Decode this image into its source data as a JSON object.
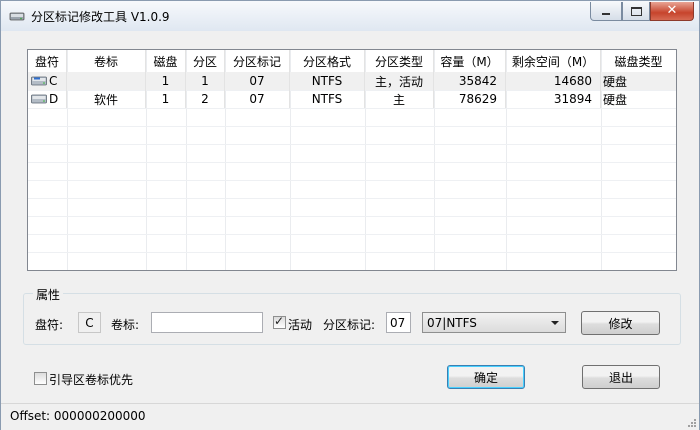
{
  "window": {
    "title": "分区标记修改工具 V1.0.9"
  },
  "titlebar": {
    "minimize": "minimize",
    "maximize": "maximize",
    "close": "✕"
  },
  "table": {
    "columns": [
      "盘符",
      "卷标",
      "磁盘",
      "分区",
      "分区标记",
      "分区格式",
      "分区类型",
      "容量（M）",
      "剩余空间（M）",
      "磁盘类型"
    ],
    "rows": [
      {
        "drive": "C",
        "label": "",
        "disk": "1",
        "partition": "1",
        "mark": "07",
        "format": "NTFS",
        "type": "主，活动",
        "capacity": "35842",
        "free": "14680",
        "disk_type": "硬盘",
        "icon": "drive-c-icon"
      },
      {
        "drive": "D",
        "label": "软件",
        "disk": "1",
        "partition": "2",
        "mark": "07",
        "format": "NTFS",
        "type": "主",
        "capacity": "78629",
        "free": "31894",
        "disk_type": "硬盘",
        "icon": "drive-d-icon"
      }
    ]
  },
  "properties": {
    "group_title": "属性",
    "drive_label": "盘符:",
    "drive_value": "C",
    "volume_label": "卷标:",
    "volume_value": "",
    "active_label": "活动",
    "active_checked": true,
    "mark_label": "分区标记:",
    "mark_value": "07",
    "format_select": "07|NTFS",
    "modify_button": "修改"
  },
  "options": {
    "boot_priority_label": "引导区卷标优先",
    "boot_priority_checked": false
  },
  "buttons": {
    "ok": "确定",
    "exit": "退出"
  },
  "status": {
    "text": "Offset: 000000200000"
  }
}
